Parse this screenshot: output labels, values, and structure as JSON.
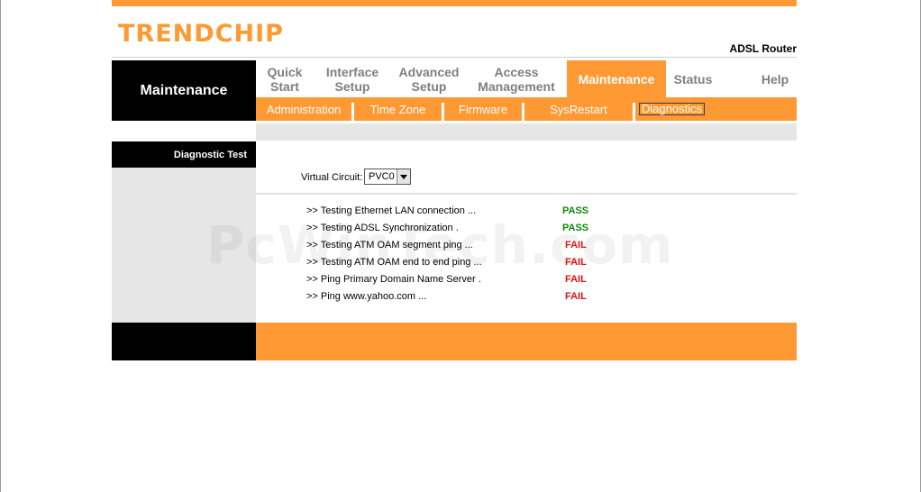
{
  "header": {
    "logo": "TRENDCHIP",
    "product": "ADSL Router"
  },
  "section": {
    "title": "Maintenance"
  },
  "nav": {
    "items": [
      {
        "line1": "Quick",
        "line2": "Start"
      },
      {
        "line1": "Interface",
        "line2": "Setup"
      },
      {
        "line1": "Advanced",
        "line2": "Setup"
      },
      {
        "line1": "Access",
        "line2": "Management"
      },
      {
        "line1": "Maintenance",
        "line2": ""
      },
      {
        "line1": "Status",
        "line2": ""
      },
      {
        "line1": "Help",
        "line2": ""
      }
    ],
    "active": "Maintenance"
  },
  "subnav": {
    "items": [
      "Administration",
      "Time Zone",
      "Firmware",
      "SysRestart",
      "Diagnostics"
    ],
    "selected": "Diagnostics"
  },
  "sidebar": {
    "heading": "Diagnostic Test"
  },
  "form": {
    "virtual_circuit_label": "Virtual Circuit:",
    "virtual_circuit_value": "PVC0"
  },
  "tests": [
    {
      "label": ">> Testing Ethernet LAN connection ...",
      "result": "PASS"
    },
    {
      "label": ">> Testing ADSL Synchronization .",
      "result": "PASS"
    },
    {
      "label": ">> Testing ATM OAM segment ping ...",
      "result": "FAIL"
    },
    {
      "label": ">> Testing ATM OAM end to end ping ...",
      "result": "FAIL"
    },
    {
      "label": ">> Ping Primary Domain Name Server .",
      "result": "FAIL"
    },
    {
      "label": ">> Ping www.yahoo.com ...",
      "result": "FAIL"
    }
  ],
  "watermark": "PcWinTech.com",
  "colors": {
    "accent": "#ff9933",
    "pass": "#0a8a0a",
    "fail": "#e01010"
  }
}
